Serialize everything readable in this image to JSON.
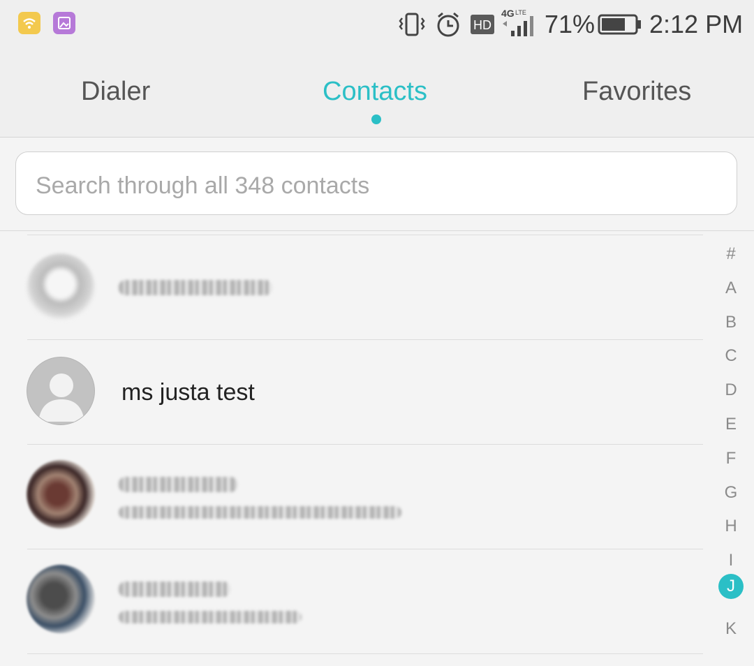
{
  "status_bar": {
    "battery_percent": "71%",
    "time": "2:12 PM",
    "network": "4G",
    "network_sub": "LTE",
    "hd_label": "HD",
    "battery_level": 0.71
  },
  "tabs": [
    {
      "label": "Dialer",
      "active": false
    },
    {
      "label": "Contacts",
      "active": true
    },
    {
      "label": "Favorites",
      "active": false
    }
  ],
  "search": {
    "placeholder": "Search through all 348 contacts",
    "value": ""
  },
  "contacts": [
    {
      "name": "",
      "avatar": "photo-blurred"
    },
    {
      "name": "ms justa test",
      "avatar": "default-person"
    },
    {
      "name": "",
      "avatar": "photo-blurred"
    },
    {
      "name": "",
      "avatar": "photo-blurred"
    }
  ],
  "alphabet_index": {
    "letters": [
      "#",
      "A",
      "B",
      "C",
      "D",
      "E",
      "F",
      "G",
      "H",
      "I",
      "J",
      "K"
    ],
    "active": "J"
  },
  "colors": {
    "accent": "#2bbfc6",
    "tab_text": "#555555"
  }
}
